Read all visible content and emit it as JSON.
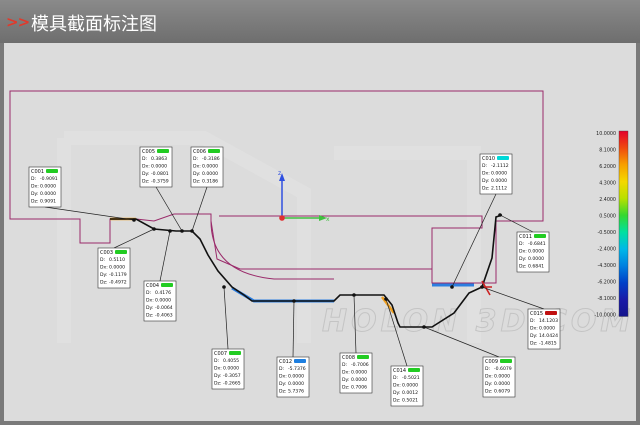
{
  "header": {
    "arrows": ">>",
    "title": "模具截面标注图"
  },
  "watermark": "HOLON 3D.COM",
  "axes": {
    "z_label": "z",
    "x_label": "x"
  },
  "colorbar": {
    "labels": [
      "10.0000",
      "8.1000",
      "6.2000",
      "4.3000",
      "2.4000",
      "0.5000",
      "-0.5000",
      "-2.4000",
      "-4.3000",
      "-6.2000",
      "-8.1000",
      "-10.0000"
    ],
    "colors": [
      "#e4002b",
      "#f04a10",
      "#f8a000",
      "#f4d800",
      "#b8e000",
      "#34d830",
      "#00e0a0",
      "#00b8e8",
      "#0080e0",
      "#0040c8",
      "#1a1aa8",
      "#14148c"
    ]
  },
  "callouts": [
    {
      "id": "C001",
      "flag": "#22cc22",
      "rows": [
        [
          "D:",
          "-0.9091"
        ],
        [
          "Dx:",
          "0.0000"
        ],
        [
          "Dy:",
          "0.0000"
        ],
        [
          "Dz:",
          "0.9091"
        ]
      ]
    },
    {
      "id": "C003",
      "flag": "#22cc22",
      "rows": [
        [
          "D:",
          "0.5110"
        ],
        [
          "Dx:",
          "0.0000"
        ],
        [
          "Dy:",
          "-0.1179"
        ],
        [
          "Dz:",
          "-0.4972"
        ]
      ]
    },
    {
      "id": "C004",
      "flag": "#22cc22",
      "rows": [
        [
          "D:",
          "0.4176"
        ],
        [
          "Dx:",
          "0.0000"
        ],
        [
          "Dy:",
          "-0.0064"
        ],
        [
          "Dz:",
          "-0.4063"
        ]
      ]
    },
    {
      "id": "C005",
      "flag": "#22cc22",
      "rows": [
        [
          "D:",
          "0.3863"
        ],
        [
          "Dx:",
          "0.0000"
        ],
        [
          "Dy:",
          "-0.0801"
        ],
        [
          "Dz:",
          "-0.3759"
        ]
      ]
    },
    {
      "id": "C006",
      "flag": "#22cc22",
      "rows": [
        [
          "D:",
          "-0.3186"
        ],
        [
          "Dx:",
          "0.0000"
        ],
        [
          "Dy:",
          "0.0000"
        ],
        [
          "Dz:",
          "0.3186"
        ]
      ]
    },
    {
      "id": "C007",
      "flag": "#22cc22",
      "rows": [
        [
          "D:",
          "0.4055"
        ],
        [
          "Dx:",
          "0.0000"
        ],
        [
          "Dy:",
          "-0.3057"
        ],
        [
          "Dz:",
          "-0.2665"
        ]
      ]
    },
    {
      "id": "C012",
      "flag": "#1e7fe0",
      "rows": [
        [
          "D:",
          "-5.7376"
        ],
        [
          "Dx:",
          "0.0000"
        ],
        [
          "Dy:",
          "0.0000"
        ],
        [
          "Dz:",
          "5.7376"
        ]
      ]
    },
    {
      "id": "C008",
      "flag": "#22cc22",
      "rows": [
        [
          "D:",
          "-0.7006"
        ],
        [
          "Dx:",
          "0.0000"
        ],
        [
          "Dy:",
          "0.0000"
        ],
        [
          "Dz:",
          "0.7006"
        ]
      ]
    },
    {
      "id": "C014",
      "flag": "#22cc22",
      "rows": [
        [
          "D:",
          "-0.5021"
        ],
        [
          "Dx:",
          "0.0000"
        ],
        [
          "Dy:",
          "0.0012"
        ],
        [
          "Dz:",
          "0.5021"
        ]
      ]
    },
    {
      "id": "C009",
      "flag": "#22cc22",
      "rows": [
        [
          "D:",
          "-0.6079"
        ],
        [
          "Dx:",
          "0.0000"
        ],
        [
          "Dy:",
          "0.0000"
        ],
        [
          "Dz:",
          "0.6079"
        ]
      ]
    },
    {
      "id": "C010",
      "flag": "#00d8d8",
      "rows": [
        [
          "D:",
          "-2.1112"
        ],
        [
          "Dx:",
          "0.0000"
        ],
        [
          "Dy:",
          "0.0000"
        ],
        [
          "Dz:",
          "2.1112"
        ]
      ]
    },
    {
      "id": "C011",
      "flag": "#22cc22",
      "rows": [
        [
          "D:",
          "-0.6841"
        ],
        [
          "Dx:",
          "0.0000"
        ],
        [
          "Dy:",
          "0.0000"
        ],
        [
          "Dz:",
          "0.6841"
        ]
      ]
    },
    {
      "id": "C015",
      "flag": "#c01010",
      "rows": [
        [
          "D:",
          "14.1203"
        ],
        [
          "Dx:",
          "0.0000"
        ],
        [
          "Dy:",
          "14.0424"
        ],
        [
          "Dz:",
          "-1.4815"
        ]
      ]
    }
  ]
}
